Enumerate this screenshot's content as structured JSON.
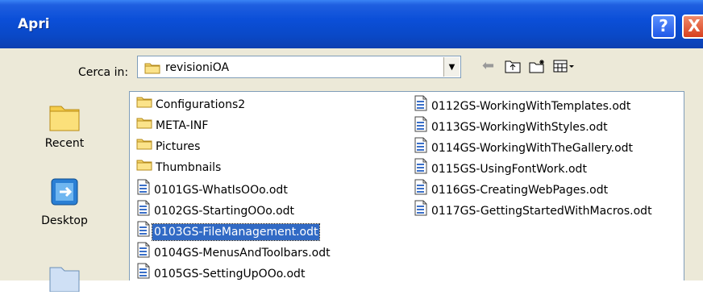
{
  "window": {
    "title": "Apri",
    "help": "?",
    "close": "X"
  },
  "toolbar": {
    "look_in_label": "Cerca in:",
    "current_folder": "revisioniOA"
  },
  "places": [
    {
      "label": "Recent",
      "icon": "recent-folder-icon"
    },
    {
      "label": "Desktop",
      "icon": "desktop-icon"
    },
    {
      "label": "",
      "icon": "my-documents-icon"
    }
  ],
  "files": {
    "col1": [
      {
        "name": "Configurations2",
        "type": "folder"
      },
      {
        "name": "META-INF",
        "type": "folder"
      },
      {
        "name": "Pictures",
        "type": "folder"
      },
      {
        "name": "Thumbnails",
        "type": "folder"
      },
      {
        "name": "0101GS-WhatIsOOo.odt",
        "type": "doc"
      },
      {
        "name": "0102GS-StartingOOo.odt",
        "type": "doc"
      },
      {
        "name": "0103GS-FileManagement.odt",
        "type": "doc",
        "selected": true
      },
      {
        "name": "0104GS-MenusAndToolbars.odt",
        "type": "doc"
      },
      {
        "name": "0105GS-SettingUpOOo.odt",
        "type": "doc"
      }
    ],
    "col2": [
      {
        "name": "0112GS-WorkingWithTemplates.odt",
        "type": "doc"
      },
      {
        "name": "0113GS-WorkingWithStyles.odt",
        "type": "doc"
      },
      {
        "name": "0114GS-WorkingWithTheGallery.odt",
        "type": "doc"
      },
      {
        "name": "0115GS-UsingFontWork.odt",
        "type": "doc"
      },
      {
        "name": "0116GS-CreatingWebPages.odt",
        "type": "doc"
      },
      {
        "name": "0117GS-GettingStartedWithMacros.odt",
        "type": "doc"
      }
    ]
  },
  "colors": {
    "selection": "#316ac5",
    "titlebar": "#0b4fd8",
    "dialog_bg": "#ece9d8"
  }
}
